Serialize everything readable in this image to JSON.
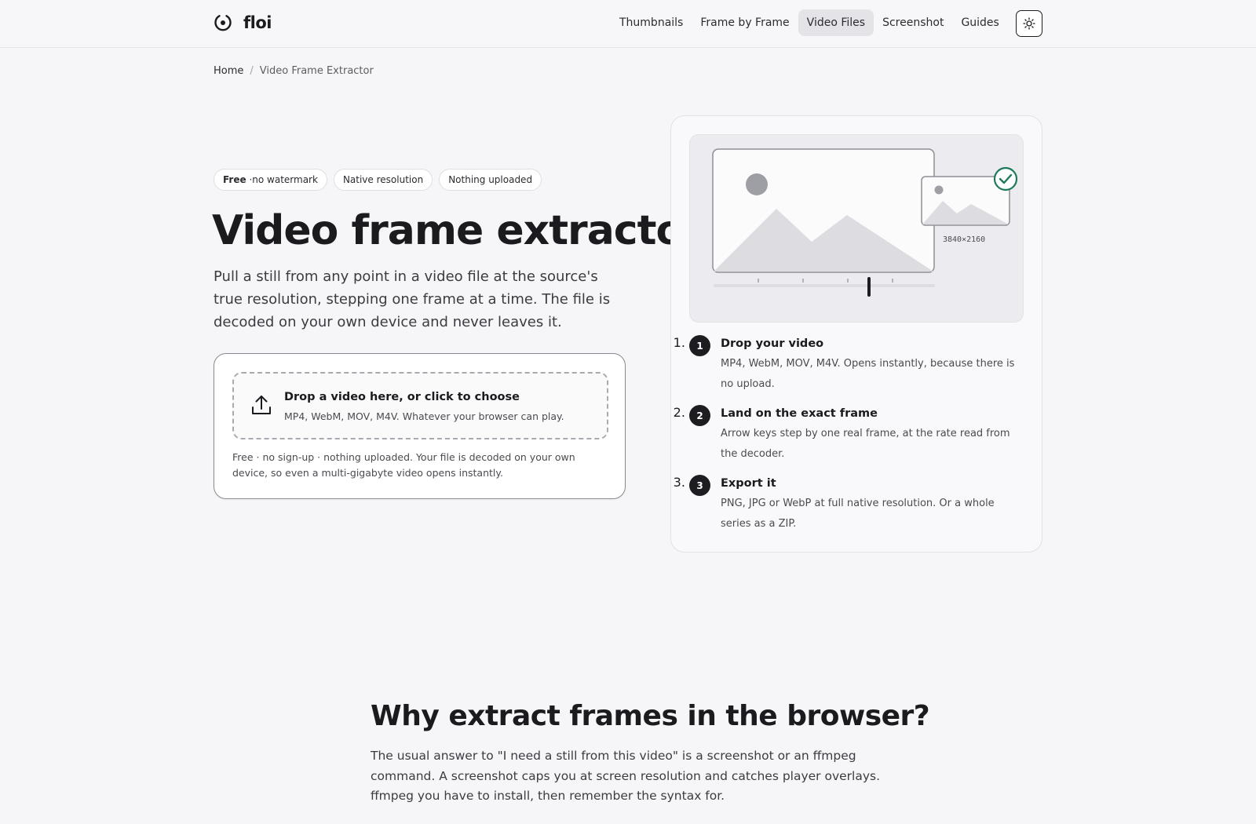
{
  "header": {
    "logo_text": "floi",
    "nav": [
      {
        "label": "Thumbnails",
        "active": false
      },
      {
        "label": "Frame by Frame",
        "active": false
      },
      {
        "label": "Video Files",
        "active": true
      },
      {
        "label": "Screenshot",
        "active": false
      },
      {
        "label": "Guides",
        "active": false
      }
    ],
    "theme_toggle_icon": "sun-icon"
  },
  "breadcrumb": {
    "home": "Home",
    "separator": "/",
    "current": "Video Frame Extractor"
  },
  "hero": {
    "chips": [
      {
        "bold": "Free",
        "text": "·no watermark"
      },
      {
        "bold": "",
        "text": "Native resolution"
      },
      {
        "bold": "",
        "text": "Nothing uploaded"
      }
    ],
    "title": "Video frame extractor",
    "subtitle": "Pull a still from any point in a video file at the source's true resolution, stepping one frame at a time. The file is decoded on your own device and never leaves it."
  },
  "upload": {
    "title": "Drop a video here, or click to choose",
    "formats": "MP4, WebM, MOV, M4V. Whatever your browser can play.",
    "note": "Free · no sign-up · nothing uploaded. Your file is decoded on your own device, so even a multi-gigabyte video opens instantly.",
    "icon": "upload-icon"
  },
  "illustration": {
    "resolution_label": "3840×2160",
    "check_color": "#1f7a5c"
  },
  "steps": [
    {
      "num": "1",
      "title": "Drop your video",
      "desc": "MP4, WebM, MOV, M4V. Opens instantly, because there is no upload."
    },
    {
      "num": "2",
      "title": "Land on the exact frame",
      "desc": "Arrow keys step by one real frame, at the rate read from the decoder."
    },
    {
      "num": "3",
      "title": "Export it",
      "desc": "PNG, JPG or WebP at full native resolution. Or a whole series as a ZIP."
    }
  ],
  "why": {
    "title": "Why extract frames in the browser?",
    "body": "The usual answer to \"I need a still from this video\" is a screenshot or an ffmpeg command. A screenshot caps you at screen resolution and catches player overlays. ffmpeg you have to install, then remember the syntax for."
  }
}
